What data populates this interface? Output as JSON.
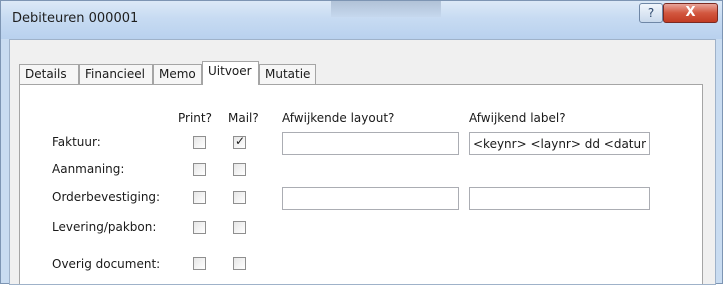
{
  "window": {
    "title": "Debiteuren 000001"
  },
  "titlebar": {
    "help_label": "?",
    "close_label": "X"
  },
  "tabs": [
    "Details",
    "Financieel",
    "Memo",
    "Uitvoer",
    "Mutatie"
  ],
  "active_tab": "Uitvoer",
  "headers": {
    "print": "Print?",
    "mail": "Mail?",
    "layout": "Afwijkende layout?",
    "label": "Afwijkend label?"
  },
  "rows": [
    {
      "label": "Faktuur:",
      "print": false,
      "mail": true,
      "layout": "",
      "custom_label": "<keynr> <laynr> dd <datum>"
    },
    {
      "label": "Aanmaning:",
      "print": false,
      "mail": false
    },
    {
      "label": "Orderbevestiging:",
      "print": false,
      "mail": false,
      "layout": "",
      "custom_label": ""
    },
    {
      "label": "Levering/pakbon:",
      "print": false,
      "mail": false
    },
    {
      "label": "Overig document:",
      "print": false,
      "mail": false
    }
  ],
  "icons": {
    "help": "help-icon",
    "close": "close-icon",
    "check": "checkmark-icon"
  }
}
